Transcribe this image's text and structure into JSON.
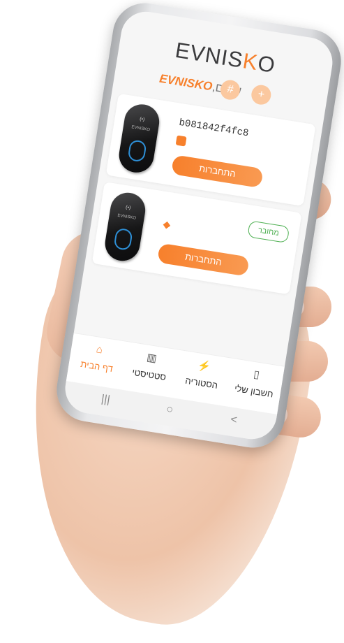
{
  "app": {
    "brand_left": "EVNIS",
    "brand_accent": "K",
    "brand_right": "O",
    "greeting_name": "EVNISKO",
    "greeting_text": "שלום,"
  },
  "header": {
    "add_icon": "+",
    "menu_icon": "#"
  },
  "chargers": [
    {
      "device_label": "EVNISKO",
      "device_led": "(•)",
      "id": "b081842f4fc8",
      "status_icon": "device-status-icon",
      "connect_label": "התחברות"
    },
    {
      "device_label": "EVNISKO",
      "device_led": "(•)",
      "status_badge": "מחובר",
      "status_icon": "wifi-icon",
      "connect_label": "התחברות"
    }
  ],
  "bottom_nav": [
    {
      "label": "דף הבית",
      "icon": "⌂",
      "active": true
    },
    {
      "label": "סטטיסטי",
      "icon": "▥",
      "active": false
    },
    {
      "label": "הסטוריה",
      "icon": "⚡",
      "active": false
    },
    {
      "label": "חשבון שלי",
      "icon": "▯",
      "active": false
    }
  ],
  "system_nav": {
    "recent": "|||",
    "home": "○",
    "back": "<"
  },
  "colors": {
    "accent": "#f7802c",
    "connected": "#4caf50"
  }
}
